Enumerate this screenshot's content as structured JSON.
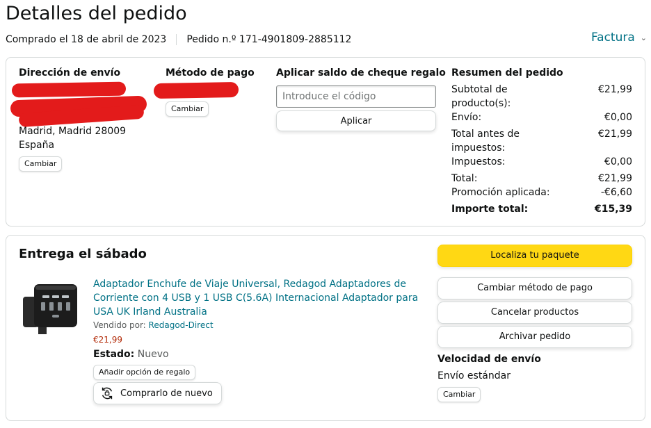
{
  "header": {
    "title": "Detalles del pedido",
    "purchased": "Comprado el 18 de abril de 2023",
    "order_number": "Pedido n.º 171-4901809-2885112",
    "invoice_label": "Factura"
  },
  "shipping": {
    "heading": "Dirección de envío",
    "city_line": "Madrid, Madrid 28009",
    "country": "España",
    "change_label": "Cambiar"
  },
  "payment": {
    "heading": "Método de pago",
    "change_label": "Cambiar"
  },
  "gift": {
    "heading": "Aplicar saldo de cheque regalo",
    "placeholder": "Introduce el código",
    "apply_label": "Aplicar"
  },
  "summary": {
    "heading": "Resumen del pedido",
    "rows": [
      {
        "label": "Subtotal de producto(s):",
        "value": "€21,99"
      },
      {
        "label": "Envío:",
        "value": "€0,00"
      },
      {
        "label": "Total antes de impuestos:",
        "value": "€21,99"
      },
      {
        "label": "Impuestos:",
        "value": "€0,00"
      },
      {
        "label": "Total:",
        "value": "€21,99"
      },
      {
        "label": "Promoción aplicada:",
        "value": "-€6,60"
      },
      {
        "label": "Importe total:",
        "value": "€15,39"
      }
    ]
  },
  "delivery": {
    "title": "Entrega el sábado",
    "product": {
      "name": "Adaptador Enchufe de Viaje Universal, Redagod Adaptadores de Corriente con 4 USB y 1 USB C(5.6A) Internacional Adaptador para USA UK Irland Australia",
      "sold_by_label": "Vendido por:",
      "seller": "Redagod-Direct",
      "price": "€21,99",
      "state_label": "Estado:",
      "state_value": "Nuevo",
      "gift_option_label": "Añadir opción de regalo",
      "buy_again_label": "Comprarlo de nuevo"
    },
    "actions": {
      "track": "Localiza tu paquete",
      "change_payment": "Cambiar método de pago",
      "cancel": "Cancelar productos",
      "archive": "Archivar pedido"
    },
    "shipping_speed": {
      "heading": "Velocidad de envío",
      "value": "Envío estándar",
      "change_label": "Cambiar"
    }
  },
  "colors": {
    "link": "#007185",
    "primary_button": "#ffd814",
    "price": "#b12704",
    "redaction": "#e31b1b"
  }
}
